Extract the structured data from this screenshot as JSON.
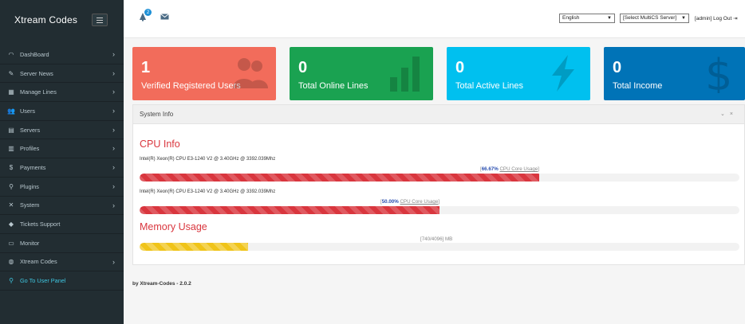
{
  "sidebar": {
    "brand": "Xtream Codes",
    "items": [
      {
        "label": "DashBoard",
        "icon": "dashboard-icon",
        "glyph": "◠",
        "arrow": true
      },
      {
        "label": "Server News",
        "icon": "pencil-icon",
        "glyph": "✎",
        "arrow": true
      },
      {
        "label": "Manage Lines",
        "icon": "grid-icon",
        "glyph": "▦",
        "arrow": true
      },
      {
        "label": "Users",
        "icon": "users-icon",
        "glyph": "👥",
        "arrow": true
      },
      {
        "label": "Servers",
        "icon": "server-icon",
        "glyph": "▤",
        "arrow": true
      },
      {
        "label": "Profiles",
        "icon": "database-icon",
        "glyph": "▥",
        "arrow": true
      },
      {
        "label": "Payments",
        "icon": "dollar-icon",
        "glyph": "$",
        "arrow": true
      },
      {
        "label": "Plugins",
        "icon": "bulb-icon",
        "glyph": "⚲",
        "arrow": true
      },
      {
        "label": "System",
        "icon": "tools-icon",
        "glyph": "✕",
        "arrow": true
      },
      {
        "label": "Tickets Support",
        "icon": "ticket-icon",
        "glyph": "◆",
        "arrow": false
      },
      {
        "label": "Monitor",
        "icon": "monitor-icon",
        "glyph": "▭",
        "arrow": false
      },
      {
        "label": "Xtream Codes",
        "icon": "globe-icon",
        "glyph": "◍",
        "arrow": true
      },
      {
        "label": "Go To User Panel",
        "icon": "bulb-icon",
        "glyph": "⚲",
        "arrow": false
      }
    ]
  },
  "header": {
    "notification_count": "2",
    "language": "English",
    "server_select": "[Select MultiCS Server]",
    "admin_text": "[admin] Log Out"
  },
  "stats": [
    {
      "value": "1",
      "label": "Verified Registered Users",
      "color": "#f26c5b",
      "icon": "users-icon"
    },
    {
      "value": "0",
      "label": "Total Online Lines",
      "color": "#1aa251",
      "icon": "bar-chart-icon"
    },
    {
      "value": "0",
      "label": "Total Active Lines",
      "color": "#00c0ef",
      "icon": "bolt-icon"
    },
    {
      "value": "0",
      "label": "Total Income",
      "color": "#0073b7",
      "icon": "dollar-icon"
    }
  ],
  "panel": {
    "title": "System Info",
    "cpu_title": "CPU Info",
    "cpus": [
      {
        "name": "Intel(R) Xeon(R) CPU E3-1240 V2 @ 3.40GHz @ 3392.039Mhz",
        "percent_text": "66.67%",
        "usage_text": "CPU Core Usage",
        "fraction": 0.6667
      },
      {
        "name": "Intel(R) Xeon(R) CPU E3-1240 V2 @ 3.40GHz @ 3392.039Mhz",
        "percent_text": "50.00%",
        "usage_text": "CPU Core Usage",
        "fraction": 0.5
      }
    ],
    "memory_title": "Memory Usage",
    "memory_text": "[740/4096] MB",
    "memory_fraction": 0.1807
  },
  "footer": "by Xtream-Codes - 2.0.2"
}
